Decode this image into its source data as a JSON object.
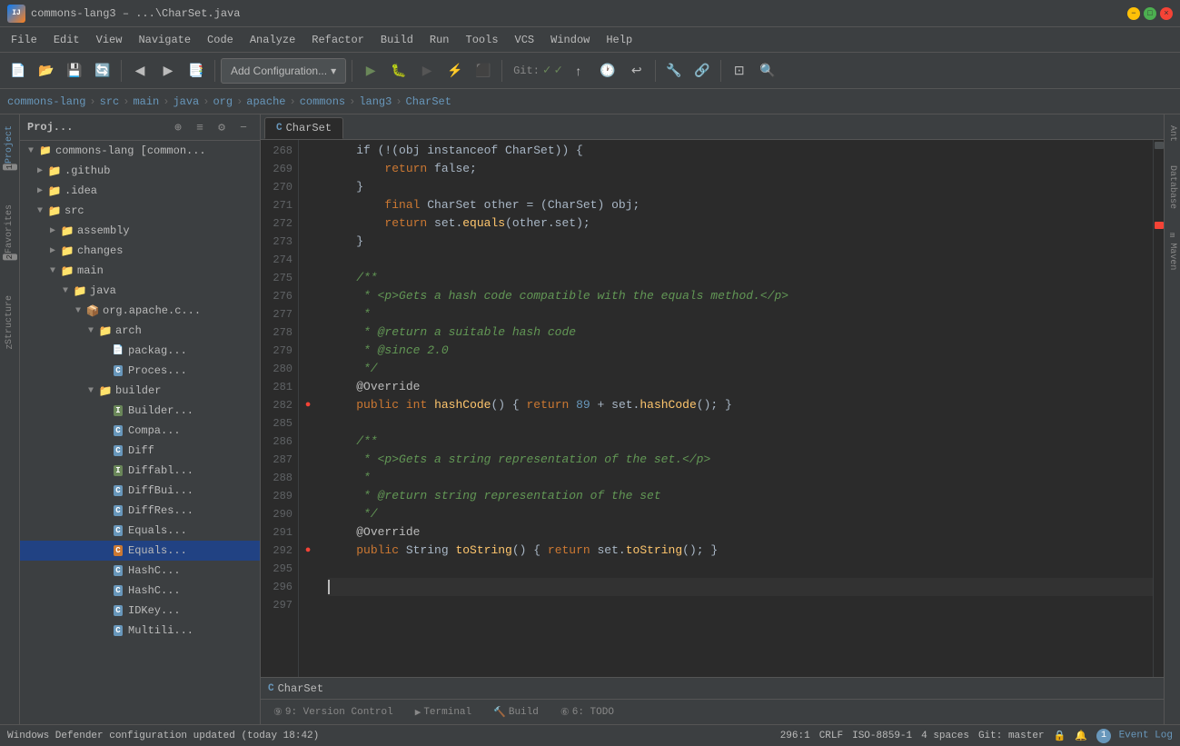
{
  "title_bar": {
    "title": "commons-lang3 – ...\\CharSet.java",
    "minimize": "−",
    "maximize": "□",
    "close": "×"
  },
  "menu": {
    "items": [
      "File",
      "Edit",
      "View",
      "Navigate",
      "Code",
      "Analyze",
      "Refactor",
      "Build",
      "Run",
      "Tools",
      "VCS",
      "Window",
      "Help"
    ]
  },
  "toolbar": {
    "add_config_label": "Add Configuration...",
    "add_config_dropdown": "▾",
    "git_label": "Git:"
  },
  "breadcrumb": {
    "items": [
      "commons-lang",
      "src",
      "main",
      "java",
      "org",
      "apache",
      "commons",
      "lang3",
      "CharSet"
    ]
  },
  "project_panel": {
    "title": "Proj...",
    "root": "commons-lang [common...",
    "items": [
      {
        "label": ".github",
        "type": "folder",
        "depth": 1,
        "expanded": false
      },
      {
        "label": ".idea",
        "type": "folder",
        "depth": 1,
        "expanded": false
      },
      {
        "label": "src",
        "type": "folder",
        "depth": 1,
        "expanded": true
      },
      {
        "label": "assembly",
        "type": "folder",
        "depth": 2,
        "expanded": false
      },
      {
        "label": "changes",
        "type": "folder",
        "depth": 2,
        "expanded": false
      },
      {
        "label": "main",
        "type": "folder",
        "depth": 2,
        "expanded": true
      },
      {
        "label": "java",
        "type": "folder",
        "depth": 3,
        "expanded": true
      },
      {
        "label": "org.apache.c...",
        "type": "package",
        "depth": 4,
        "expanded": true
      },
      {
        "label": "arch",
        "type": "folder",
        "depth": 5,
        "expanded": true
      },
      {
        "label": "packag...",
        "type": "file",
        "depth": 6
      },
      {
        "label": "Proces...",
        "type": "class",
        "depth": 6
      },
      {
        "label": "builder",
        "type": "folder",
        "depth": 5,
        "expanded": true
      },
      {
        "label": "Builder...",
        "type": "interface",
        "depth": 6
      },
      {
        "label": "Compa...",
        "type": "class",
        "depth": 6
      },
      {
        "label": "Diff",
        "type": "class",
        "depth": 6
      },
      {
        "label": "Diffabl...",
        "type": "interface",
        "depth": 6
      },
      {
        "label": "DiffBui...",
        "type": "class",
        "depth": 6
      },
      {
        "label": "DiffRes...",
        "type": "class",
        "depth": 6
      },
      {
        "label": "Equals...",
        "type": "class",
        "depth": 6
      },
      {
        "label": "Equals...",
        "type": "class",
        "depth": 6,
        "selected": true
      },
      {
        "label": "HashC...",
        "type": "class",
        "depth": 6
      },
      {
        "label": "HashC...",
        "type": "class",
        "depth": 6
      },
      {
        "label": "IDKey...",
        "type": "class",
        "depth": 6
      },
      {
        "label": "Multili...",
        "type": "class",
        "depth": 6
      }
    ]
  },
  "code": {
    "file_name": "CharSet",
    "lines": [
      {
        "num": 268,
        "text": "    if (!(obj instanceof CharSet)) {",
        "indent": "        "
      },
      {
        "num": 269,
        "text": "        return false;",
        "tokens": [
          {
            "t": "        "
          },
          {
            "t": "return",
            "c": "kw"
          },
          {
            "t": " false;"
          }
        ]
      },
      {
        "num": 270,
        "text": "    }",
        "tokens": [
          {
            "t": "    }"
          }
        ]
      },
      {
        "num": 271,
        "text": "    final CharSet other = (CharSet) obj;",
        "tokens": [
          {
            "t": "        "
          },
          {
            "t": "final",
            "c": "kw"
          },
          {
            "t": " CharSet other = (CharSet) obj;"
          }
        ]
      },
      {
        "num": 272,
        "text": "    return set.equals(other.set);",
        "tokens": [
          {
            "t": "        "
          },
          {
            "t": "return",
            "c": "kw"
          },
          {
            "t": " set."
          },
          {
            "t": "equals",
            "c": "fn"
          },
          {
            "t": "(other.set);"
          }
        ]
      },
      {
        "num": 273,
        "text": "    }",
        "tokens": [
          {
            "t": "    }"
          }
        ]
      },
      {
        "num": 274,
        "text": ""
      },
      {
        "num": 275,
        "text": "    /**",
        "tokens": [
          {
            "t": "    /**",
            "c": "cmt-doc"
          }
        ]
      },
      {
        "num": 276,
        "text": "     * <p>Gets a hash code compatible with the equals method.</p>",
        "tokens": [
          {
            "t": "     * ",
            "c": "cmt-doc"
          },
          {
            "t": "<p>",
            "c": "cmt-tag"
          },
          {
            "t": "Gets a hash code compatible with the equals method.",
            "c": "cmt-doc"
          },
          {
            "t": "</p>",
            "c": "cmt-tag"
          }
        ]
      },
      {
        "num": 277,
        "text": "     *",
        "tokens": [
          {
            "t": "     *",
            "c": "cmt-doc"
          }
        ]
      },
      {
        "num": 278,
        "text": "     * @return a suitable hash code",
        "tokens": [
          {
            "t": "     * ",
            "c": "cmt-doc"
          },
          {
            "t": "@return",
            "c": "cmt-tag"
          },
          {
            "t": " a suitable hash code",
            "c": "cmt-doc"
          }
        ]
      },
      {
        "num": 279,
        "text": "     * @since 2.0",
        "tokens": [
          {
            "t": "     * ",
            "c": "cmt-doc"
          },
          {
            "t": "@since",
            "c": "cmt-tag"
          },
          {
            "t": " 2.0",
            "c": "cmt-doc"
          }
        ]
      },
      {
        "num": 280,
        "text": "     */",
        "tokens": [
          {
            "t": "     */",
            "c": "cmt-doc"
          }
        ]
      },
      {
        "num": 281,
        "text": "    @Override",
        "tokens": [
          {
            "t": "    "
          },
          {
            "t": "@Override",
            "c": "annotation"
          }
        ]
      },
      {
        "num": 282,
        "text": "    public int hashCode() { return 89 + set.hashCode(); }",
        "marker": true,
        "tokens": [
          {
            "t": "    "
          },
          {
            "t": "public",
            "c": "kw"
          },
          {
            "t": " "
          },
          {
            "t": "int",
            "c": "kw"
          },
          {
            "t": " "
          },
          {
            "t": "hashCode",
            "c": "fn"
          },
          {
            "t": "() { "
          },
          {
            "t": "return",
            "c": "kw"
          },
          {
            "t": " "
          },
          {
            "t": "89",
            "c": "num"
          },
          {
            "t": " + set."
          },
          {
            "t": "hashCode",
            "c": "fn"
          },
          {
            "t": "(); }"
          }
        ]
      },
      {
        "num": 285,
        "text": ""
      },
      {
        "num": 286,
        "text": "    /**",
        "tokens": [
          {
            "t": "    /**",
            "c": "cmt-doc"
          }
        ]
      },
      {
        "num": 287,
        "text": "     * <p>Gets a string representation of the set.</p>",
        "tokens": [
          {
            "t": "     * ",
            "c": "cmt-doc"
          },
          {
            "t": "<p>",
            "c": "cmt-tag"
          },
          {
            "t": "Gets a string representation of the set.",
            "c": "cmt-doc"
          },
          {
            "t": "</p>",
            "c": "cmt-tag"
          }
        ]
      },
      {
        "num": 288,
        "text": "     *",
        "tokens": [
          {
            "t": "     *",
            "c": "cmt-doc"
          }
        ]
      },
      {
        "num": 289,
        "text": "     * @return string representation of the set",
        "tokens": [
          {
            "t": "     * ",
            "c": "cmt-doc"
          },
          {
            "t": "@return",
            "c": "cmt-tag"
          },
          {
            "t": " string representation of the set",
            "c": "cmt-doc"
          }
        ]
      },
      {
        "num": 290,
        "text": "     */",
        "tokens": [
          {
            "t": "     */",
            "c": "cmt-doc"
          }
        ]
      },
      {
        "num": 291,
        "text": "    @Override",
        "tokens": [
          {
            "t": "    "
          },
          {
            "t": "@Override",
            "c": "annotation"
          }
        ]
      },
      {
        "num": 292,
        "text": "    public String toString() { return set.toString(); }",
        "marker": true,
        "tokens": [
          {
            "t": "    "
          },
          {
            "t": "public",
            "c": "kw"
          },
          {
            "t": " String "
          },
          {
            "t": "toString",
            "c": "fn"
          },
          {
            "t": "() { "
          },
          {
            "t": "return",
            "c": "kw"
          },
          {
            "t": " set."
          },
          {
            "t": "toString",
            "c": "fn"
          },
          {
            "t": "(); }"
          }
        ]
      },
      {
        "num": 295,
        "text": ""
      },
      {
        "num": 296,
        "text": "",
        "cursor": true
      },
      {
        "num": 297,
        "text": ""
      }
    ]
  },
  "editor_tabs": [
    {
      "label": "CharSet",
      "active": true,
      "icon": "C"
    }
  ],
  "bottom_tabs": [
    {
      "label": "9: Version Control",
      "icon": "⑨",
      "active": false
    },
    {
      "label": "Terminal",
      "icon": "▶",
      "active": false
    },
    {
      "label": "Build",
      "icon": "🔨",
      "active": false
    },
    {
      "label": "6: TODO",
      "icon": "⑥",
      "active": false
    }
  ],
  "status_bar": {
    "message": "Windows Defender configuration updated (today 18:42)",
    "position": "296:1",
    "line_ending": "CRLF",
    "encoding": "ISO-8859-1",
    "indent": "4 spaces",
    "vcs": "Git: master",
    "event_log": "Event Log",
    "event_num": "1"
  },
  "right_side_tabs": [
    "Ant",
    "Database",
    "m Maven"
  ],
  "left_side_tabs": [
    "1: Project",
    "2: Favorites",
    "Z: Structure"
  ]
}
